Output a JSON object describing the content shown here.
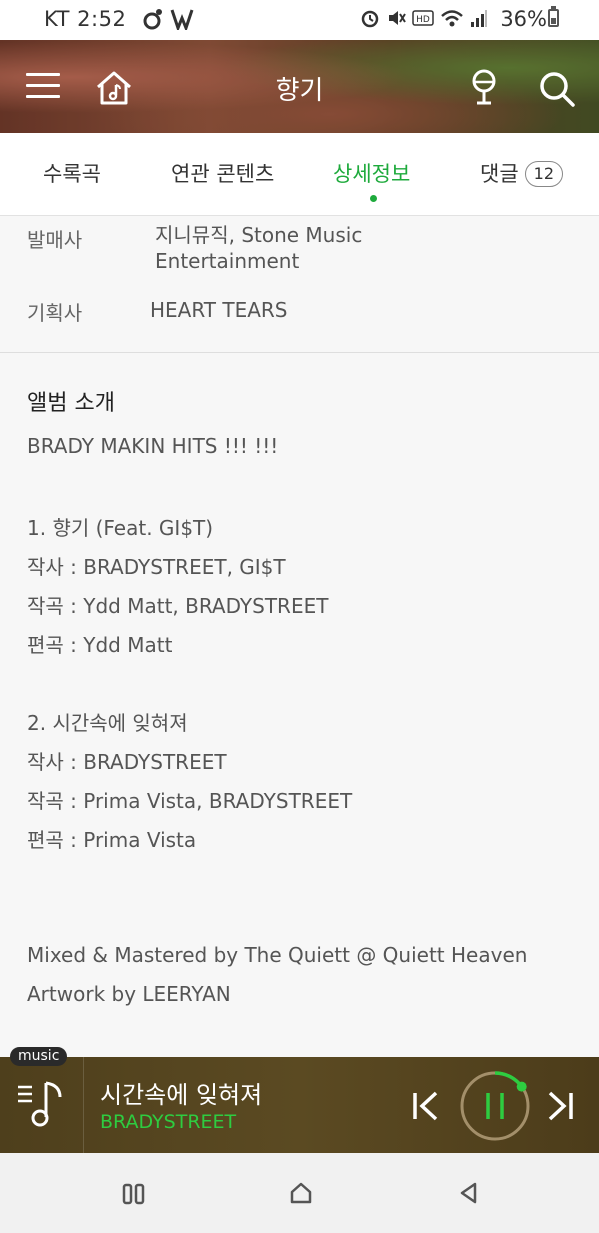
{
  "status_bar": {
    "carrier_time": "KT 2:52",
    "battery": "36%"
  },
  "header": {
    "title": "향기"
  },
  "tabs": [
    {
      "label": "수록곡"
    },
    {
      "label": "연관 콘텐츠"
    },
    {
      "label": "상세정보"
    },
    {
      "label": "댓글",
      "badge": "12"
    }
  ],
  "info": {
    "publisher_label": "발매사",
    "publisher_line1": "지니뮤직, Stone Music",
    "publisher_line2": "Entertainment",
    "agency_label": "기획사",
    "agency_value": "HEART TEARS"
  },
  "album_intro": {
    "title": "앨범 소개",
    "lines": [
      "BRADY MAKIN HITS !!! !!!",
      "1. 향기 (Feat. GI$T)",
      "작사 : BRADYSTREET, GI$T",
      "작곡 : Ydd Matt, BRADYSTREET",
      "편곡 : Ydd Matt",
      "2. 시간속에 잊혀져",
      "작사 : BRADYSTREET",
      "작곡 : Prima Vista, BRADYSTREET",
      "편곡 : Prima Vista",
      "Mixed & Mastered by The Quiett @ Quiett Heaven",
      "Artwork by LEERYAN"
    ]
  },
  "player": {
    "tag": "music",
    "title": "시간속에 잊혀져",
    "artist": "BRADYSTREET",
    "progress": 0.15
  },
  "colors": {
    "accent": "#1eaa3c",
    "artist": "#2ecc40"
  }
}
